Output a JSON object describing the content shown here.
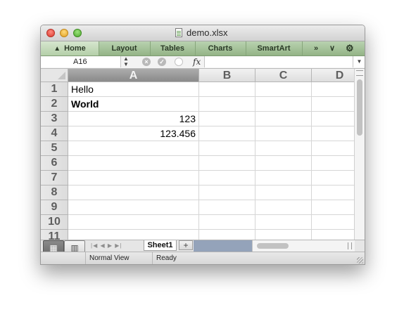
{
  "window": {
    "title": "demo.xlsx"
  },
  "ribbon": {
    "home_icon": "house-icon",
    "tabs": [
      "Home",
      "Layout",
      "Tables",
      "Charts",
      "SmartArt"
    ],
    "overflow": "»",
    "collapse": "∨",
    "gear": "⚙"
  },
  "formula_bar": {
    "name_box": "A16",
    "fx": "fx",
    "formula": ""
  },
  "sheet": {
    "columns": [
      "A",
      "B",
      "C",
      "D"
    ],
    "selected_column": "A",
    "rows": [
      "1",
      "2",
      "3",
      "4",
      "5",
      "6",
      "7",
      "8",
      "9",
      "10",
      "11"
    ],
    "cells": [
      {
        "ref": "A1",
        "value": "Hello",
        "bold": false,
        "align": "left"
      },
      {
        "ref": "A2",
        "value": "World",
        "bold": true,
        "align": "left"
      },
      {
        "ref": "A3",
        "value": "123",
        "bold": false,
        "align": "right"
      },
      {
        "ref": "A4",
        "value": "123.456",
        "bold": false,
        "align": "right"
      }
    ]
  },
  "tabs_bar": {
    "sheet_tab": "Sheet1",
    "add_sheet": "+"
  },
  "status": {
    "view": "Normal View",
    "state": "Ready"
  }
}
